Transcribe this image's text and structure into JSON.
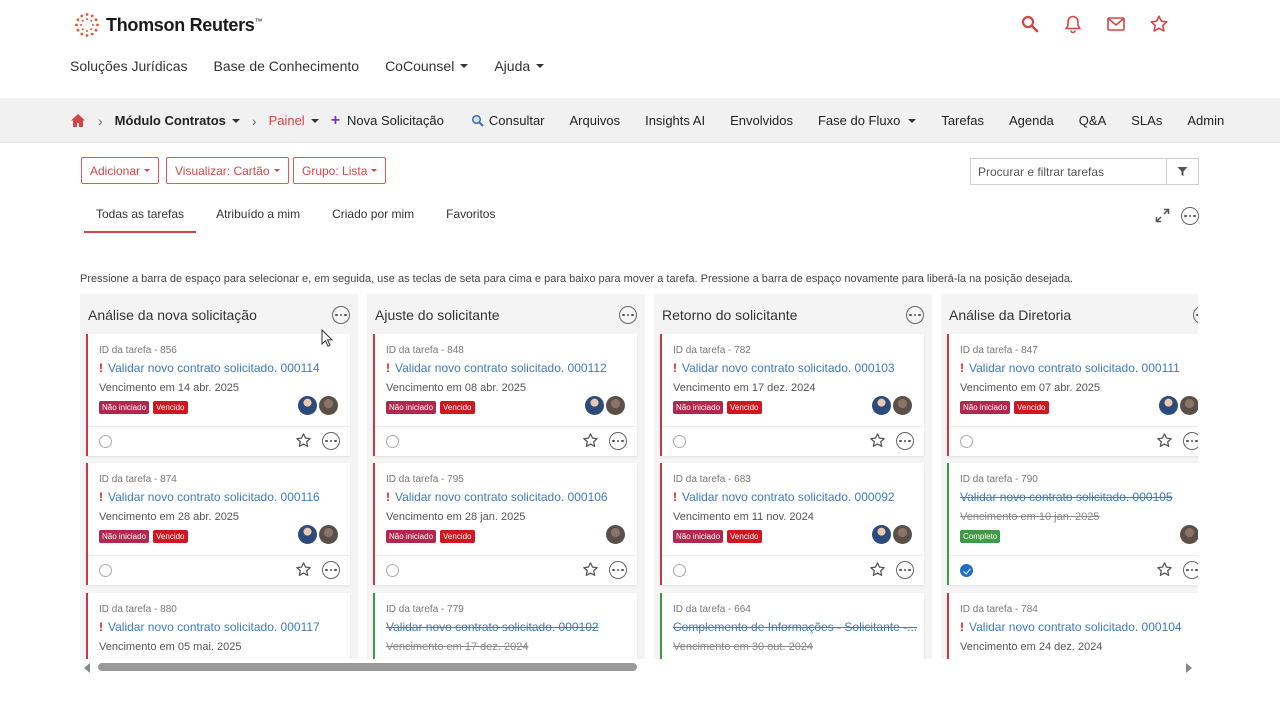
{
  "brand": {
    "name": "Thomson Reuters",
    "tm": "™",
    "accent": "#d64545"
  },
  "top_icons": [
    "search-icon",
    "bell-icon",
    "mail-icon",
    "star-icon"
  ],
  "main_nav": {
    "items": [
      {
        "label": "Soluções Jurídicas",
        "dropdown": false
      },
      {
        "label": "Base de Conhecimento",
        "dropdown": false
      },
      {
        "label": "CoCounsel",
        "dropdown": true
      },
      {
        "label": "Ajuda",
        "dropdown": true
      }
    ]
  },
  "module_bar": {
    "module": "Módulo Contratos",
    "current": "Painel",
    "links": [
      {
        "label": "Nova Solicitação",
        "icon": "plus-icon"
      },
      {
        "label": "Consultar",
        "icon": "search-icon"
      },
      {
        "label": "Arquivos"
      },
      {
        "label": "Insights AI"
      },
      {
        "label": "Envolvidos"
      },
      {
        "label": "Fase do Fluxo",
        "dropdown": true
      },
      {
        "label": "Tarefas"
      },
      {
        "label": "Agenda"
      },
      {
        "label": "Q&A"
      },
      {
        "label": "SLAs"
      },
      {
        "label": "Admin"
      }
    ]
  },
  "toolbar": {
    "add_label": "Adicionar",
    "view_label": "Visualizar: Cartão",
    "group_label": "Grupo: Lista",
    "search_placeholder": "Procurar e filtrar tarefas"
  },
  "tabs": [
    {
      "label": "Todas as tarefas",
      "active": true
    },
    {
      "label": "Atribuído a mim",
      "active": false
    },
    {
      "label": "Criado por mim",
      "active": false
    },
    {
      "label": "Favoritos",
      "active": false
    }
  ],
  "hint": "Pressione a barra de espaço para selecionar e, em seguida, use as teclas de seta para cima e para baixo para mover a tarefa. Pressione a barra de espaço novamente para liberá-la na posição desejada.",
  "columns": [
    {
      "title": "Análise da nova solicitação",
      "cards": [
        {
          "id": "ID da tarefa - 856",
          "title": "Validar novo contrato solicitado. 000114",
          "due": "Vencimento em 14 abr. 2025",
          "status": [
            "Não iniciado",
            "Vencido"
          ],
          "avatars": 2,
          "done": false
        },
        {
          "id": "ID da tarefa - 874",
          "title": "Validar novo contrato solicitado. 000116",
          "due": "Vencimento em 28 abr. 2025",
          "status": [
            "Não iniciado",
            "Vencido"
          ],
          "avatars": 2,
          "done": false
        },
        {
          "id": "ID da tarefa - 880",
          "title": "Validar novo contrato solicitado. 000117",
          "due": "Vencimento em 05 mai. 2025",
          "status": [],
          "avatars": 0,
          "done": false
        }
      ]
    },
    {
      "title": "Ajuste do solicitante",
      "cards": [
        {
          "id": "ID da tarefa - 848",
          "title": "Validar novo contrato solicitado. 000112",
          "due": "Vencimento em 08 abr. 2025",
          "status": [
            "Não iniciado",
            "Vencido"
          ],
          "avatars": 2,
          "done": false
        },
        {
          "id": "ID da tarefa - 795",
          "title": "Validar novo contrato solicitado. 000106",
          "due": "Vencimento em 28 jan. 2025",
          "status": [
            "Não iniciado",
            "Vencido"
          ],
          "avatars": 1,
          "done": false
        },
        {
          "id": "ID da tarefa - 779",
          "title": "Validar novo contrato solicitado. 000102",
          "due": "Vencimento em 17 dez. 2024",
          "status": [],
          "avatars": 0,
          "done": true
        }
      ]
    },
    {
      "title": "Retorno do solicitante",
      "cards": [
        {
          "id": "ID da tarefa - 782",
          "title": "Validar novo contrato solicitado. 000103",
          "due": "Vencimento em 17 dez. 2024",
          "status": [
            "Não iniciado",
            "Vencido"
          ],
          "avatars": 2,
          "done": false
        },
        {
          "id": "ID da tarefa - 683",
          "title": "Validar novo contrato solicitado. 000092",
          "due": "Vencimento em 11 nov. 2024",
          "status": [
            "Não iniciado",
            "Vencido"
          ],
          "avatars": 2,
          "done": false
        },
        {
          "id": "ID da tarefa - 664",
          "title": "Complemento de Informações - Solicitante -...",
          "due": "Vencimento em 30 out. 2024",
          "status": [],
          "avatars": 0,
          "done": true
        }
      ]
    },
    {
      "title": "Análise da Diretoria",
      "cards": [
        {
          "id": "ID da tarefa - 847",
          "title": "Validar novo contrato solicitado. 000111",
          "due": "Vencimento em 07 abr. 2025",
          "status": [
            "Não iniciado",
            "Vencido"
          ],
          "avatars": 2,
          "done": false
        },
        {
          "id": "ID da tarefa - 790",
          "title": "Validar novo contrato solicitado. 000105",
          "due": "Vencimento em 10 jan. 2025",
          "status": [
            "Completo"
          ],
          "avatars": 1,
          "done": true
        },
        {
          "id": "ID da tarefa - 784",
          "title": "Validar novo contrato solicitado. 000104",
          "due": "Vencimento em 24 dez. 2024",
          "status": [],
          "avatars": 0,
          "done": false
        }
      ]
    }
  ]
}
